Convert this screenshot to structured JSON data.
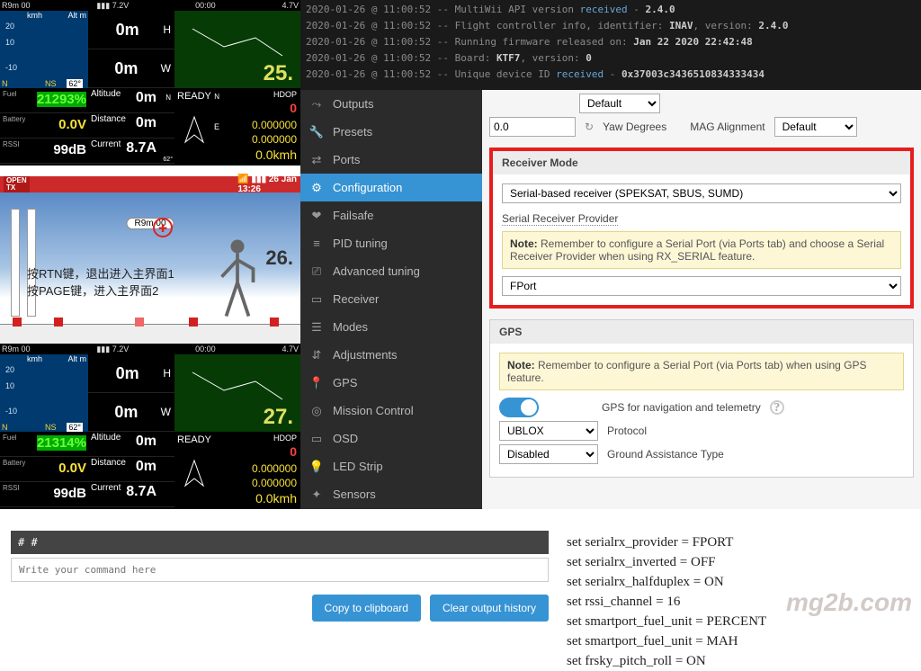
{
  "console": [
    {
      "ts": "2020-01-26 @ 11:00:52",
      "plain": "MultiWii API version ",
      "hl": "received",
      "tail": " - ",
      "bold": "2.4.0"
    },
    {
      "ts": "2020-01-26 @ 11:00:52",
      "plain": "Flight controller info, identifier: ",
      "bold1": "INAV",
      "mid": ", version: ",
      "bold2": "2.4.0"
    },
    {
      "ts": "2020-01-26 @ 11:00:52",
      "plain": "Running firmware released on: ",
      "bold": "Jan 22 2020 22:42:48"
    },
    {
      "ts": "2020-01-26 @ 11:00:52",
      "plain": "Board: ",
      "bold1": "KTF7",
      "mid": ", version: ",
      "bold2": "0"
    },
    {
      "ts": "2020-01-26 @ 11:00:52",
      "plain": "Unique device ID ",
      "hl": "received",
      "tail": " - ",
      "bold": "0x37003c3436510834333434"
    }
  ],
  "tele_header": {
    "left": "R9m 00",
    "bat_icon": "▮▮▮",
    "v1": "7.2V",
    "time": "00:00",
    "v2": "4.7V"
  },
  "tele_left": {
    "unit_top": "kmh",
    "unit_r": "Alt m",
    "s1": "20",
    "s2": "10",
    "s3": "-10",
    "dir": "N",
    "hdg": "62°",
    "ns": "NS"
  },
  "tele_mid": {
    "box1_lbl": "",
    "box1_val": "0m",
    "box1_unit": "H",
    "box2_lbl": "",
    "box2_val": "0m",
    "box2_unit": "W"
  },
  "tele_right": {
    "unit": "E",
    "num25": "25.",
    "num26": "26.",
    "num27": "27."
  },
  "tele_stats": {
    "fuel_label": "Fuel",
    "fuel_val": "21293%",
    "fuel_val2": "21314%",
    "batt_label": "Battery",
    "batt_val": "0.0V",
    "rssi_label": "RSSI",
    "rssi_val": "99dB",
    "alt_label": "Altitude",
    "alt_val": "0m",
    "alt_dir": "N",
    "dist_label": "Distance",
    "dist_val": "0m",
    "cur_label": "Current",
    "cur_val": "8.7A",
    "cur_deg": "62°",
    "ready": "READY",
    "ready_dir": "N",
    "hdop": "HDOP",
    "hdop_val": "0",
    "lat": "0.000000",
    "lon": "0.000000",
    "spd": "0.0kmh"
  },
  "opentx": {
    "badge": "OPEN\nTX",
    "date": "26 Jan",
    "time": "13:26",
    "r9m": "R9m 00",
    "line1": "按RTN键，退出进入主界面1",
    "line2": "按PAGE键，进入主界面2"
  },
  "sidebar": [
    {
      "label": "Outputs",
      "icon": "⤳"
    },
    {
      "label": "Presets",
      "icon": "🔧"
    },
    {
      "label": "Ports",
      "icon": "⇄"
    },
    {
      "label": "Configuration",
      "icon": "⚙",
      "active": true
    },
    {
      "label": "Failsafe",
      "icon": "❤"
    },
    {
      "label": "PID tuning",
      "icon": "≡"
    },
    {
      "label": "Advanced tuning",
      "icon": "⎚"
    },
    {
      "label": "Receiver",
      "icon": "▭"
    },
    {
      "label": "Modes",
      "icon": "☰"
    },
    {
      "label": "Adjustments",
      "icon": "⇵"
    },
    {
      "label": "GPS",
      "icon": "📍"
    },
    {
      "label": "Mission Control",
      "icon": "◎"
    },
    {
      "label": "OSD",
      "icon": "▭"
    },
    {
      "label": "LED Strip",
      "icon": "💡"
    },
    {
      "label": "Sensors",
      "icon": "✦"
    }
  ],
  "cfg": {
    "top_val": "0.0",
    "yaw_icon_label": "Yaw Degrees",
    "mag_label": "MAG Alignment",
    "mag_val": "Default",
    "rx_panel": "Receiver Mode",
    "rx_val": "Serial-based receiver (SPEKSAT, SBUS, SUMD)",
    "srp_label": "Serial Receiver Provider",
    "note1": "Remember to configure a Serial Port (via Ports tab) and choose a Serial Receiver Provider when using RX_SERIAL feature.",
    "srp_val": "FPort",
    "gps_panel": "GPS",
    "note2": "Remember to configure a Serial Port (via Ports tab) when using GPS feature.",
    "gps_toggle_label": "GPS for navigation and telemetry",
    "gps_proto_val": "UBLOX",
    "gps_proto_label": "Protocol",
    "gps_ground_val": "Disabled",
    "gps_ground_label": "Ground Assistance Type",
    "note_prefix": "Note:"
  },
  "cli": {
    "prompt": "# #",
    "placeholder": "Write your command here",
    "btn1": "Copy to clipboard",
    "btn2": "Clear output history"
  },
  "sets": [
    "set serialrx_provider = FPORT",
    "set serialrx_inverted = OFF",
    "set serialrx_halfduplex = ON",
    "set rssi_channel = 16",
    "set smartport_fuel_unit = PERCENT",
    "set smartport_fuel_unit = MAH",
    "set frsky_pitch_roll = ON"
  ],
  "watermark": "mg2b.com"
}
